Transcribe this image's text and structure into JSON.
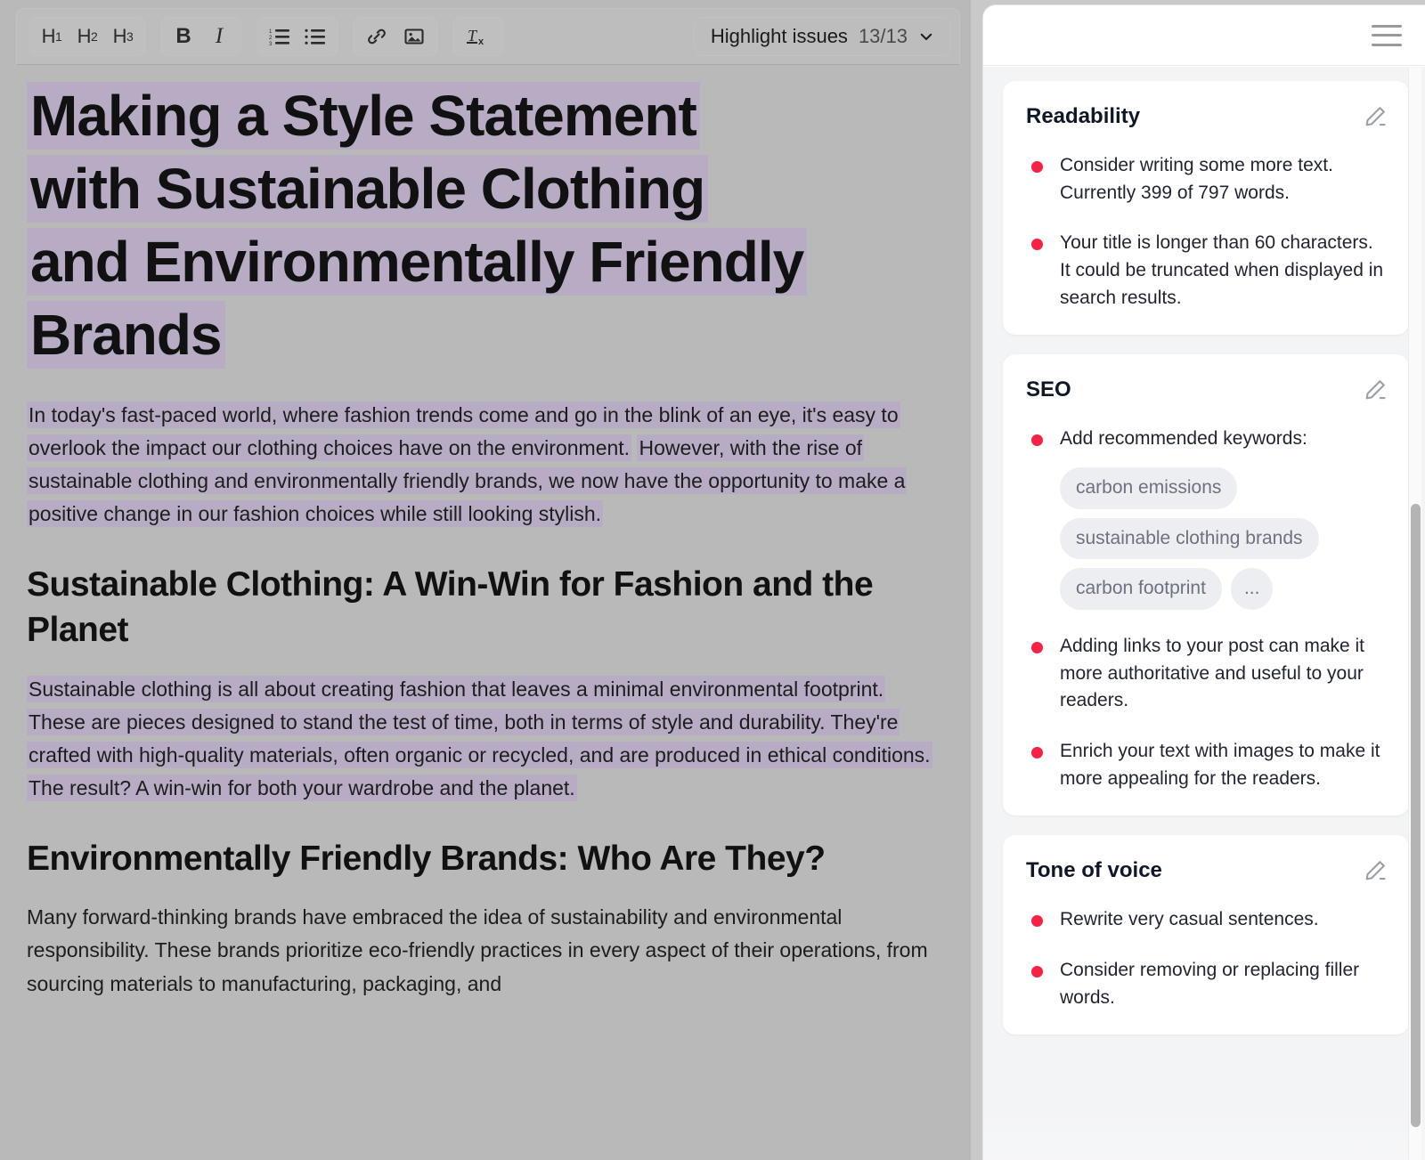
{
  "editor": {
    "toolbar": {
      "groups": [
        {
          "name": "headings",
          "buttons": [
            {
              "name": "heading-1-button",
              "label": "H",
              "sub": "1"
            },
            {
              "name": "heading-2-button",
              "label": "H",
              "sub": "2"
            },
            {
              "name": "heading-3-button",
              "label": "H",
              "sub": "3"
            }
          ]
        },
        {
          "name": "inline-format",
          "buttons": [
            {
              "name": "bold-button",
              "label": "B"
            },
            {
              "name": "italic-button",
              "label": "I"
            }
          ]
        },
        {
          "name": "lists",
          "buttons": [
            {
              "name": "ordered-list-button",
              "label": "ordered-list-icon"
            },
            {
              "name": "bullet-list-button",
              "label": "bullet-list-icon"
            }
          ]
        },
        {
          "name": "insert",
          "buttons": [
            {
              "name": "link-button",
              "label": "link-icon"
            },
            {
              "name": "image-button",
              "label": "image-icon"
            }
          ]
        },
        {
          "name": "clear",
          "buttons": [
            {
              "name": "clear-formatting-button",
              "label": "clear-formatting-icon"
            }
          ]
        }
      ]
    },
    "highlight_issues": {
      "label": "Highlight issues",
      "count": "13/13",
      "chevron": "chevron-down-icon"
    },
    "document": {
      "title_lines": [
        "Making a Style Statement",
        "with Sustainable Clothing",
        "and Environmentally Friendly",
        "Brands"
      ],
      "paragraph_1_a": "In today's fast-paced world, where fashion trends come and go in the blink of an eye, it's easy to overlook the impact our clothing choices have on the environment.",
      "paragraph_1_b": "However, with the rise of sustainable clothing and environmentally friendly brands, we now have the opportunity to make a positive change in our fashion choices while still looking stylish.",
      "heading_2a": "Sustainable Clothing: A Win-Win for Fashion and the Planet",
      "paragraph_2": "Sustainable clothing is all about creating fashion that leaves a minimal environmental footprint. These are pieces designed to stand the test of time, both in terms of style and durability. They're crafted with high-quality materials, often organic or recycled, and are produced in ethical conditions. The result? A win-win for both your wardrobe and the planet.",
      "heading_2b": "Environmentally Friendly Brands: Who Are They?",
      "paragraph_3": "Many forward-thinking brands have embraced the idea of sustainability and environmental responsibility. These brands prioritize eco-friendly practices in every aspect of their operations, from sourcing materials to manufacturing, packaging, and"
    }
  },
  "sidebar": {
    "menu_icon": "hamburger-menu-icon",
    "cards": [
      {
        "title": "Readability",
        "edit_icon": "pencil-edit-icon",
        "tips": [
          {
            "text": "Consider writing some more text. Currently 399 of 797 words."
          },
          {
            "text": "Your title is longer than 60 characters. It could be truncated when displayed in search results."
          }
        ]
      },
      {
        "title": "SEO",
        "edit_icon": "pencil-edit-icon",
        "tips": [
          {
            "text": "Add recommended keywords:",
            "chips": [
              "carbon emissions",
              "sustainable clothing brands",
              "carbon footprint",
              "..."
            ]
          },
          {
            "text": "Adding links to your post can make it more authoritative and useful to your readers."
          },
          {
            "text": "Enrich your text with images to make it more appealing for the readers."
          }
        ]
      },
      {
        "title": "Tone of voice",
        "edit_icon": "pencil-edit-icon",
        "tips": [
          {
            "text": "Rewrite very casual sentences."
          },
          {
            "text": "Consider removing or replacing filler words."
          }
        ]
      }
    ]
  },
  "colors": {
    "highlight": "#b7acc4",
    "bullet_red": "#f72146",
    "editor_bg": "#b9b9b9",
    "sidebar_bg": "#f3f4f6",
    "chip_bg": "#eceef1"
  }
}
